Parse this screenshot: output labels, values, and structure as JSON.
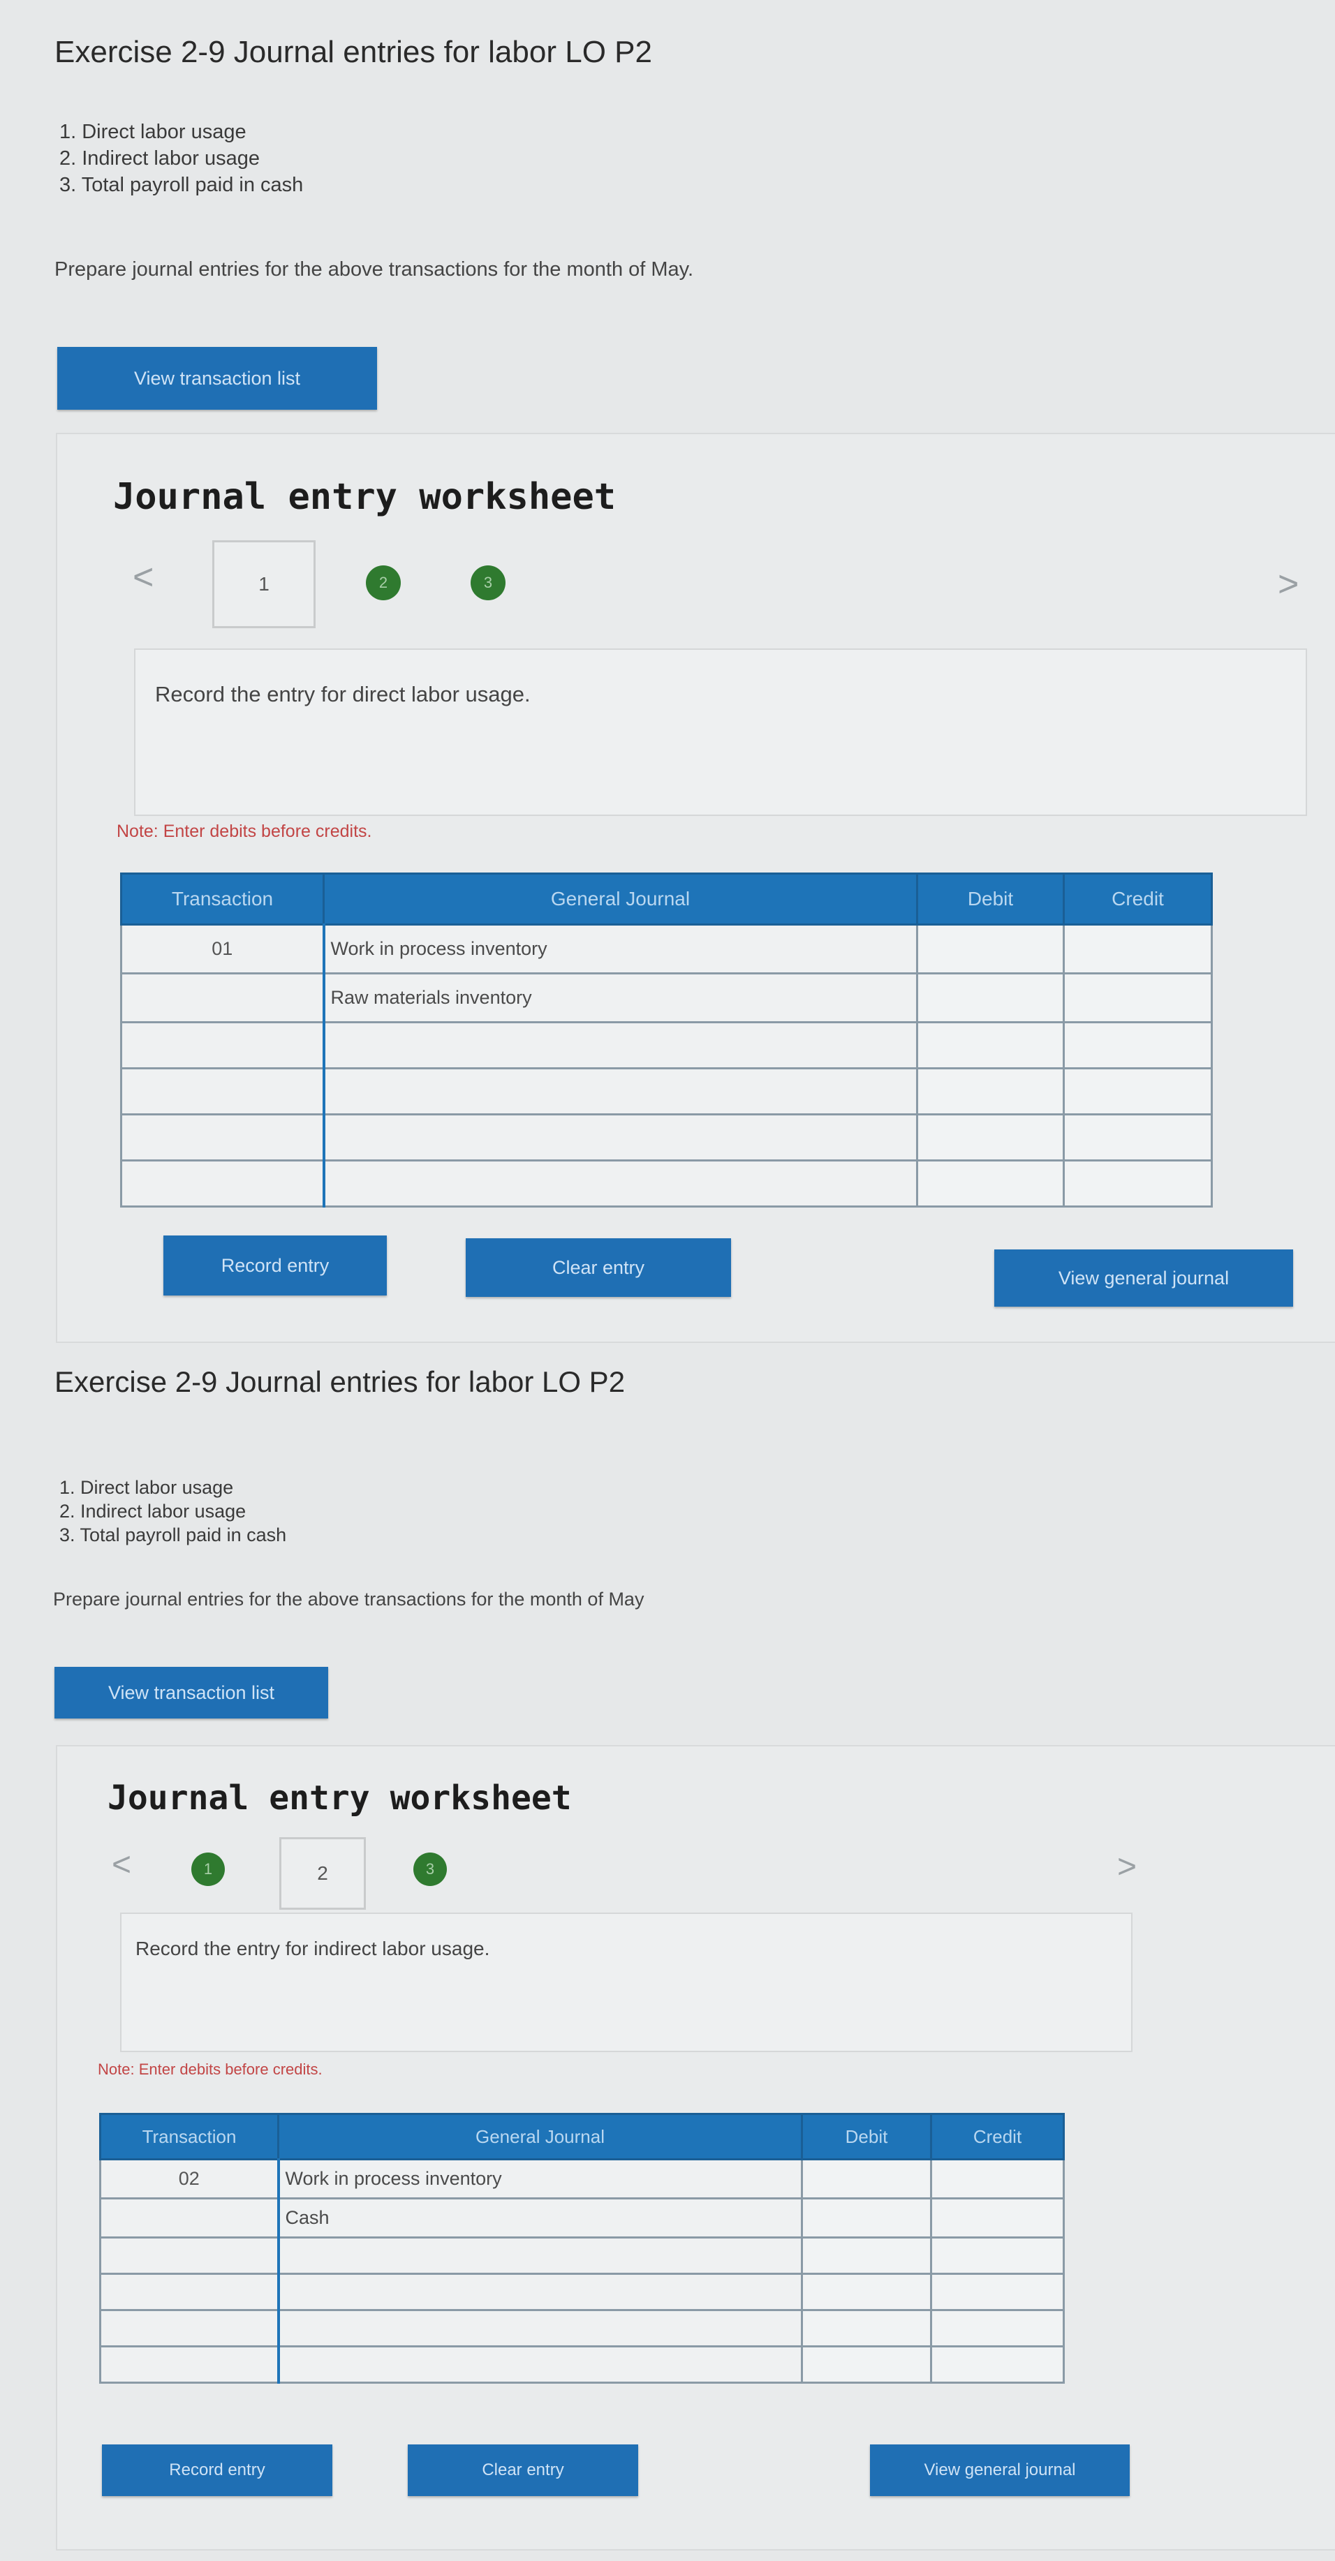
{
  "sections": [
    {
      "exercise_title": "Exercise 2-9 Journal entries for labor LO P2",
      "requirements": [
        "1. Direct labor usage",
        "2. Indirect labor usage",
        "3. Total payroll paid in cash"
      ],
      "prepare_text": "Prepare journal entries for the above transactions for the month of May.",
      "view_transactions_label": "View transaction list",
      "worksheet_title": "Journal entry worksheet",
      "tabs": [
        "1",
        "2",
        "3"
      ],
      "active_tab": "1",
      "instruction": "Record the entry for direct labor usage.",
      "note": "Note: Enter debits before credits.",
      "table": {
        "headers": [
          "Transaction",
          "General Journal",
          "Debit",
          "Credit"
        ],
        "rows": [
          {
            "transaction": "01",
            "account": "Work in process inventory",
            "debit": "",
            "credit": ""
          },
          {
            "transaction": "",
            "account": "Raw materials inventory",
            "debit": "",
            "credit": ""
          },
          {
            "transaction": "",
            "account": "",
            "debit": "",
            "credit": ""
          },
          {
            "transaction": "",
            "account": "",
            "debit": "",
            "credit": ""
          },
          {
            "transaction": "",
            "account": "",
            "debit": "",
            "credit": ""
          },
          {
            "transaction": "",
            "account": "",
            "debit": "",
            "credit": ""
          }
        ]
      },
      "record_label": "Record entry",
      "clear_label": "Clear entry",
      "view_journal_label": "View general journal"
    },
    {
      "exercise_title": "Exercise 2-9 Journal entries for labor LO P2",
      "requirements": [
        "1. Direct labor usage",
        "2. Indirect labor usage",
        "3. Total payroll paid in cash"
      ],
      "prepare_text": "Prepare journal entries for the above transactions for the month of May",
      "view_transactions_label": "View transaction list",
      "worksheet_title": "Journal entry worksheet",
      "tabs": [
        "1",
        "2",
        "3"
      ],
      "active_tab": "2",
      "instruction": "Record the entry for indirect labor usage.",
      "note": "Note: Enter debits before credits.",
      "table": {
        "headers": [
          "Transaction",
          "General Journal",
          "Debit",
          "Credit"
        ],
        "rows": [
          {
            "transaction": "02",
            "account": "Work in process inventory",
            "debit": "",
            "credit": ""
          },
          {
            "transaction": "",
            "account": "Cash",
            "debit": "",
            "credit": ""
          },
          {
            "transaction": "",
            "account": "",
            "debit": "",
            "credit": ""
          },
          {
            "transaction": "",
            "account": "",
            "debit": "",
            "credit": ""
          },
          {
            "transaction": "",
            "account": "",
            "debit": "",
            "credit": ""
          },
          {
            "transaction": "",
            "account": "",
            "debit": "",
            "credit": ""
          }
        ]
      },
      "record_label": "Record entry",
      "clear_label": "Clear entry",
      "view_journal_label": "View general journal"
    }
  ],
  "nav": {
    "prev_glyph": "<",
    "next_glyph": ">"
  },
  "colors": {
    "accent": "#1f6fb4",
    "tab_done": "#2f7a2f",
    "note": "#c24545"
  }
}
